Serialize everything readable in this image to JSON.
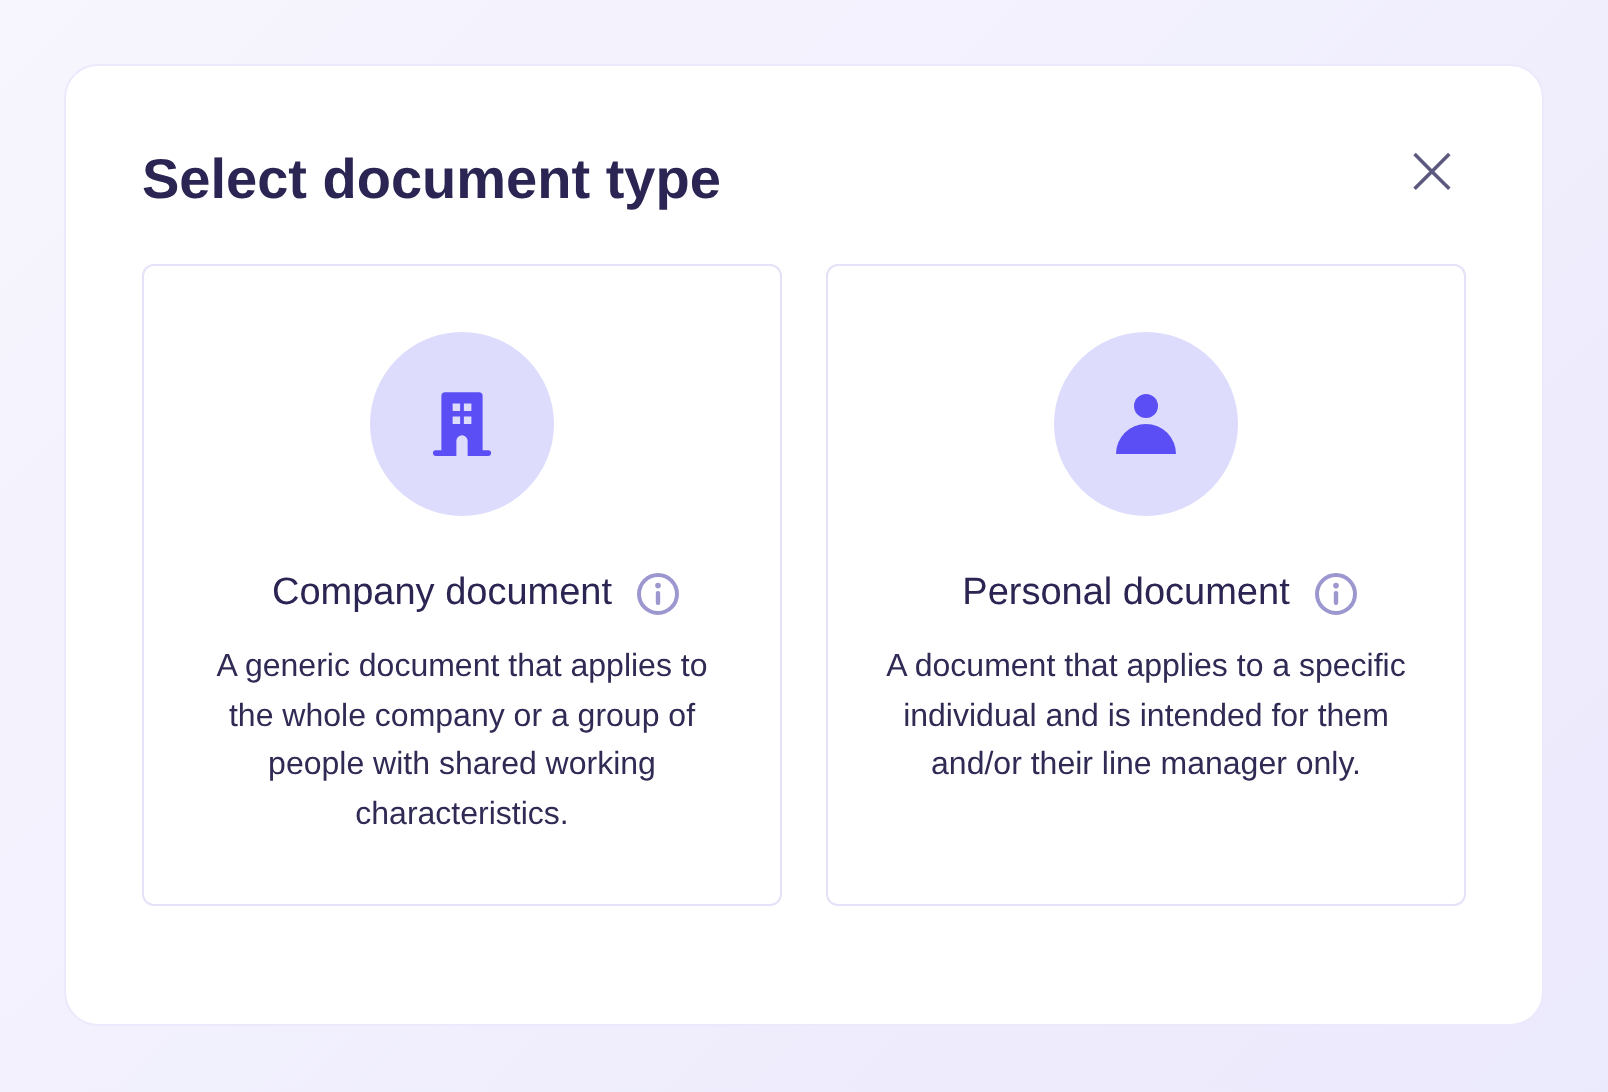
{
  "dialog": {
    "title": "Select document type",
    "close": "×"
  },
  "options": [
    {
      "kind": "company",
      "title": "Company document",
      "description": "A generic document that applies to the whole company or a group of people with shared working characteristics."
    },
    {
      "kind": "personal",
      "title": "Personal document",
      "description": "A document that applies to a specific individual and is intended for them and/or their line manager only."
    }
  ]
}
